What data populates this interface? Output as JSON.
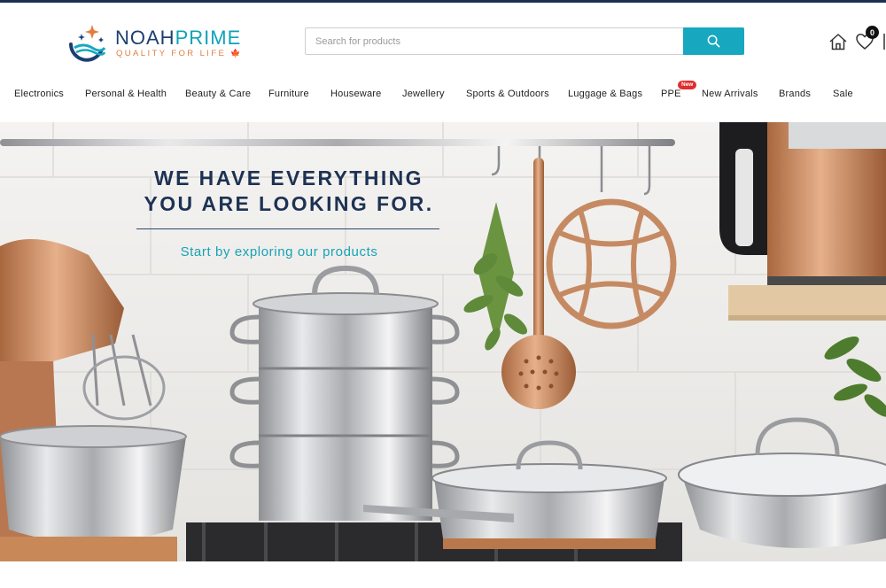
{
  "header": {
    "brand_noah": "NOAH",
    "brand_prime": "PRIME",
    "tagline": "QUALITY FOR LIFE",
    "tagline_flag": "🍁",
    "search_placeholder": "Search for products",
    "search_value": "",
    "wishlist_count": "0"
  },
  "icons": {
    "search": "search-icon",
    "home": "home-icon",
    "wishlist": "heart-icon",
    "cart": "cart-icon"
  },
  "nav": {
    "items": [
      "Electronics",
      "Personal & Health",
      "Beauty & Care",
      "Furniture",
      "Houseware",
      "Jewellery",
      "Sports & Outdoors",
      "Luggage & Bags",
      "PPE",
      "New Arrivals",
      "Brands",
      "Sale"
    ],
    "new_badge": "New"
  },
  "hero": {
    "title_line1": "WE HAVE EVERYTHING",
    "title_line2": "YOU ARE LOOKING FOR.",
    "subtitle": "Start by exploring our products"
  },
  "colors": {
    "brand_navy": "#1c3f72",
    "brand_teal": "#17a8bf",
    "tagline_orange": "#e27d3f",
    "badge_red": "#e02d2d"
  }
}
